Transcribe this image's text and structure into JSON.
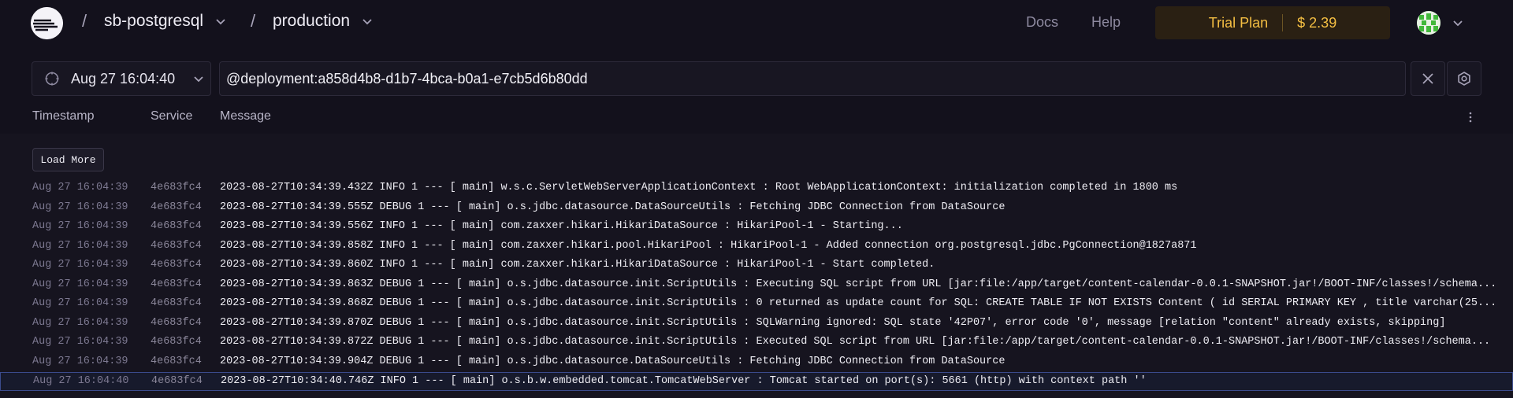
{
  "header": {
    "project": "sb-postgresql",
    "environment": "production",
    "links": {
      "docs": "Docs",
      "help": "Help"
    },
    "trial": {
      "plan": "Trial Plan",
      "amount": "$ 2.39",
      "color": "#f5bf43"
    },
    "separator": "/"
  },
  "filter": {
    "date": "Aug 27 16:04:40",
    "query": "@deployment:a858d4b8-d1b7-4bca-b0a1-e7cb5d6b80dd"
  },
  "columns": {
    "timestamp": "Timestamp",
    "service": "Service",
    "message": "Message"
  },
  "load_more": "Load More",
  "logs": [
    {
      "timestamp": "Aug 27 16:04:39",
      "service": "4e683fc4",
      "message": "2023-08-27T10:34:39.432Z INFO 1 --- [ main] w.s.c.ServletWebServerApplicationContext : Root WebApplicationContext: initialization completed in 1800 ms"
    },
    {
      "timestamp": "Aug 27 16:04:39",
      "service": "4e683fc4",
      "message": "2023-08-27T10:34:39.555Z DEBUG 1 --- [ main] o.s.jdbc.datasource.DataSourceUtils : Fetching JDBC Connection from DataSource"
    },
    {
      "timestamp": "Aug 27 16:04:39",
      "service": "4e683fc4",
      "message": "2023-08-27T10:34:39.556Z INFO 1 --- [ main] com.zaxxer.hikari.HikariDataSource : HikariPool-1 - Starting..."
    },
    {
      "timestamp": "Aug 27 16:04:39",
      "service": "4e683fc4",
      "message": "2023-08-27T10:34:39.858Z INFO 1 --- [ main] com.zaxxer.hikari.pool.HikariPool : HikariPool-1 - Added connection org.postgresql.jdbc.PgConnection@1827a871"
    },
    {
      "timestamp": "Aug 27 16:04:39",
      "service": "4e683fc4",
      "message": "2023-08-27T10:34:39.860Z INFO 1 --- [ main] com.zaxxer.hikari.HikariDataSource : HikariPool-1 - Start completed."
    },
    {
      "timestamp": "Aug 27 16:04:39",
      "service": "4e683fc4",
      "message": "2023-08-27T10:34:39.863Z DEBUG 1 --- [ main] o.s.jdbc.datasource.init.ScriptUtils : Executing SQL script from URL [jar:file:/app/target/content-calendar-0.0.1-SNAPSHOT.jar!/BOOT-INF/classes!/schema..."
    },
    {
      "timestamp": "Aug 27 16:04:39",
      "service": "4e683fc4",
      "message": "2023-08-27T10:34:39.868Z DEBUG 1 --- [ main] o.s.jdbc.datasource.init.ScriptUtils : 0 returned as update count for SQL: CREATE TABLE IF NOT EXISTS Content ( id SERIAL PRIMARY KEY , title varchar(25..."
    },
    {
      "timestamp": "Aug 27 16:04:39",
      "service": "4e683fc4",
      "message": "2023-08-27T10:34:39.870Z DEBUG 1 --- [ main] o.s.jdbc.datasource.init.ScriptUtils : SQLWarning ignored: SQL state '42P07', error code '0', message [relation \"content\" already exists, skipping]"
    },
    {
      "timestamp": "Aug 27 16:04:39",
      "service": "4e683fc4",
      "message": "2023-08-27T10:34:39.872Z DEBUG 1 --- [ main] o.s.jdbc.datasource.init.ScriptUtils : Executed SQL script from URL [jar:file:/app/target/content-calendar-0.0.1-SNAPSHOT.jar!/BOOT-INF/classes!/schema..."
    },
    {
      "timestamp": "Aug 27 16:04:39",
      "service": "4e683fc4",
      "message": "2023-08-27T10:34:39.904Z DEBUG 1 --- [ main] o.s.jdbc.datasource.DataSourceUtils : Fetching JDBC Connection from DataSource"
    },
    {
      "timestamp": "Aug 27 16:04:40",
      "service": "4e683fc4",
      "message": "2023-08-27T10:34:40.746Z INFO 1 --- [ main] o.s.b.w.embedded.tomcat.TomcatWebServer : Tomcat started on port(s): 5661 (http) with context path ''",
      "selected": true
    }
  ],
  "icons": {
    "logo": "railway-logo-icon",
    "date": "clock-icon",
    "clear": "close-icon",
    "settings": "gear-icon",
    "menu": "more-vertical-icon",
    "chevron": "chevron-down-icon"
  }
}
